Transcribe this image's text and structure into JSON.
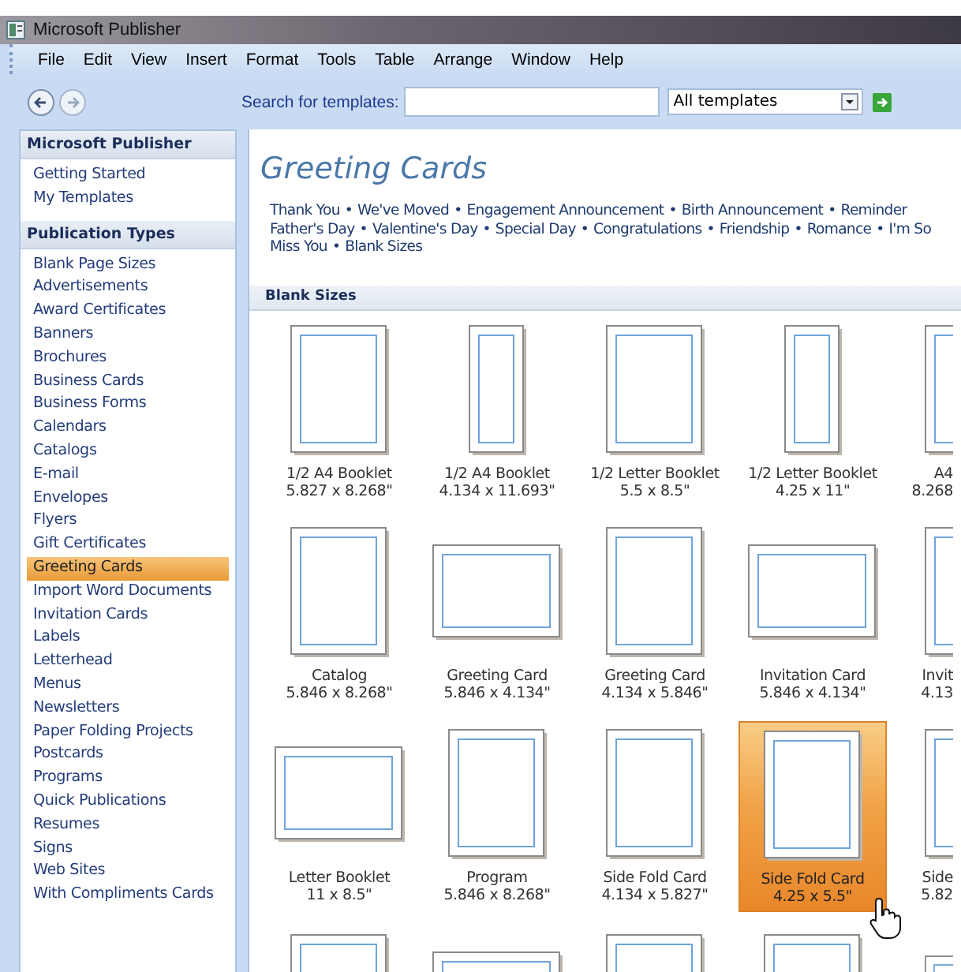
{
  "window": {
    "title": "Microsoft Publisher"
  },
  "menu": [
    "File",
    "Edit",
    "View",
    "Insert",
    "Format",
    "Tools",
    "Table",
    "Arrange",
    "Window",
    "Help"
  ],
  "toolbar": {
    "search_label": "Search for templates:",
    "scope": "All templates"
  },
  "sidebar": {
    "sections": [
      {
        "title": "Microsoft Publisher",
        "items": [
          {
            "label": "Getting Started",
            "selected": false
          },
          {
            "label": "My Templates",
            "selected": false
          }
        ]
      },
      {
        "title": "Publication Types",
        "items": [
          {
            "label": "Blank Page Sizes",
            "selected": false
          },
          {
            "label": "Advertisements",
            "selected": false
          },
          {
            "label": "Award Certificates",
            "selected": false
          },
          {
            "label": "Banners",
            "selected": false
          },
          {
            "label": "Brochures",
            "selected": false
          },
          {
            "label": "Business Cards",
            "selected": false
          },
          {
            "label": "Business Forms",
            "selected": false
          },
          {
            "label": "Calendars",
            "selected": false
          },
          {
            "label": "Catalogs",
            "selected": false
          },
          {
            "label": "E-mail",
            "selected": false
          },
          {
            "label": "Envelopes",
            "selected": false
          },
          {
            "label": "Flyers",
            "selected": false
          },
          {
            "label": "Gift Certificates",
            "selected": false
          },
          {
            "label": "Greeting Cards",
            "selected": true
          },
          {
            "label": "Import Word Documents",
            "selected": false
          },
          {
            "label": "Invitation Cards",
            "selected": false
          },
          {
            "label": "Labels",
            "selected": false
          },
          {
            "label": "Letterhead",
            "selected": false
          },
          {
            "label": "Menus",
            "selected": false
          },
          {
            "label": "Newsletters",
            "selected": false
          },
          {
            "label": "Paper Folding Projects",
            "selected": false
          },
          {
            "label": "Postcards",
            "selected": false
          },
          {
            "label": "Programs",
            "selected": false
          },
          {
            "label": "Quick Publications",
            "selected": false
          },
          {
            "label": "Resumes",
            "selected": false
          },
          {
            "label": "Signs",
            "selected": false
          },
          {
            "label": "Web Sites",
            "selected": false
          },
          {
            "label": "With Compliments Cards",
            "selected": false
          }
        ]
      }
    ]
  },
  "content": {
    "title": "Greeting Cards",
    "separator": "•",
    "category_lines": [
      [
        "Thank You",
        "We've Moved",
        "Engagement Announcement",
        "Birth Announcement",
        "Reminder"
      ],
      [
        "Father's Day",
        "Valentine's Day",
        "Special Day",
        "Congratulations",
        "Friendship",
        "Romance",
        "I'm So"
      ],
      [
        "Miss You",
        "Blank Sizes"
      ]
    ],
    "section": "Blank Sizes",
    "templates": [
      {
        "name": "1/2 A4 Booklet",
        "size": "5.827 x 8.268\"",
        "kind": "portrait",
        "selected": false
      },
      {
        "name": "1/2 A4 Booklet",
        "size": "4.134 x 11.693\"",
        "kind": "narrow",
        "selected": false
      },
      {
        "name": "1/2 Letter Booklet",
        "size": "5.5 x 8.5\"",
        "kind": "portrait",
        "selected": false
      },
      {
        "name": "1/2 Letter Booklet",
        "size": "4.25 x 11\"",
        "kind": "narrow",
        "selected": false
      },
      {
        "name": "A4",
        "size": "8.268",
        "kind": "portrait",
        "selected": false
      },
      {
        "name": "Catalog",
        "size": "5.846 x 8.268\"",
        "kind": "portrait",
        "selected": false
      },
      {
        "name": "Greeting Card",
        "size": "5.846 x 4.134\"",
        "kind": "landscape",
        "selected": false
      },
      {
        "name": "Greeting Card",
        "size": "4.134 x 5.846\"",
        "kind": "portrait",
        "selected": false
      },
      {
        "name": "Invitation Card",
        "size": "5.846 x 4.134\"",
        "kind": "landscape",
        "selected": false
      },
      {
        "name": "Invit",
        "size": "4.13",
        "kind": "portrait",
        "selected": false
      },
      {
        "name": "Letter Booklet",
        "size": "11 x 8.5\"",
        "kind": "landscape",
        "selected": false
      },
      {
        "name": "Program",
        "size": "5.846 x 8.268\"",
        "kind": "portrait",
        "selected": false
      },
      {
        "name": "Side Fold Card",
        "size": "4.134 x 5.827\"",
        "kind": "portrait",
        "selected": false
      },
      {
        "name": "Side Fold Card",
        "size": "4.25 x 5.5\"",
        "kind": "portrait",
        "selected": true
      },
      {
        "name": "Side",
        "size": "5.82",
        "kind": "portrait",
        "selected": false
      },
      {
        "kind": "portrait",
        "selected": false
      },
      {
        "kind": "landscape",
        "selected": false
      },
      {
        "kind": "portrait",
        "selected": false
      },
      {
        "kind": "portrait",
        "selected": false
      },
      {
        "kind": "landscape",
        "selected": false
      }
    ]
  }
}
